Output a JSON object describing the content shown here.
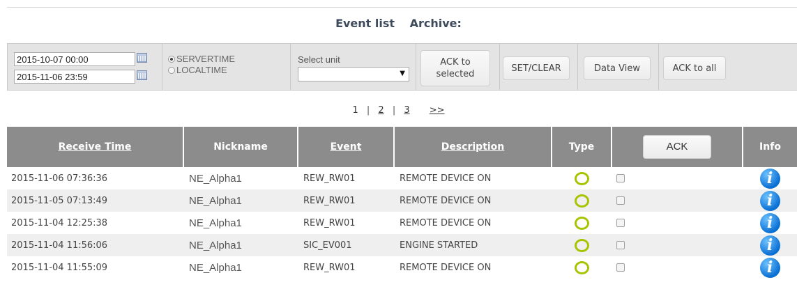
{
  "heading": {
    "event_list": "Event list",
    "archive": "Archive:"
  },
  "toolbar": {
    "date_from": "2015-10-07 00:00",
    "date_to": "2015-11-06 23:59",
    "radio_servertime": "SERVERTIME",
    "radio_localtime": "LOCALTIME",
    "selected_time_mode": "SERVERTIME",
    "select_unit_label": "Select unit",
    "select_unit_value": "",
    "ack_selected_label": "ACK to selected",
    "set_clear_label": "SET/CLEAR",
    "data_view_label": "Data View",
    "ack_all_label": "ACK to all"
  },
  "pager": {
    "current": "1",
    "pages": [
      "2",
      "3"
    ],
    "next": ">>"
  },
  "table": {
    "headers": {
      "receive_time": "Receive Time",
      "nickname": "Nickname",
      "event": "Event",
      "description": "Description",
      "type": "Type",
      "ack": "ACK",
      "info": "Info"
    },
    "rows": [
      {
        "time": "2015-11-06 07:36:36",
        "nickname": "NE_Alpha1",
        "event": "REW_RW01",
        "description": "REMOTE DEVICE ON"
      },
      {
        "time": "2015-11-05 07:13:49",
        "nickname": "NE_Alpha1",
        "event": "REW_RW01",
        "description": "REMOTE DEVICE ON"
      },
      {
        "time": "2015-11-04 12:25:38",
        "nickname": "NE_Alpha1",
        "event": "REW_RW01",
        "description": "REMOTE DEVICE ON"
      },
      {
        "time": "2015-11-04 11:56:06",
        "nickname": "NE_Alpha1",
        "event": "SIC_EV001",
        "description": "ENGINE STARTED"
      },
      {
        "time": "2015-11-04 11:55:09",
        "nickname": "NE_Alpha1",
        "event": "REW_RW01",
        "description": "REMOTE DEVICE ON"
      }
    ],
    "type_icon": "green-ring-icon",
    "info_icon": "info-icon",
    "info_glyph": "i"
  },
  "colors": {
    "header_bg": "#8c8c8c",
    "type_ring": "#a8c400",
    "info_blue": "#0a6fd3"
  }
}
